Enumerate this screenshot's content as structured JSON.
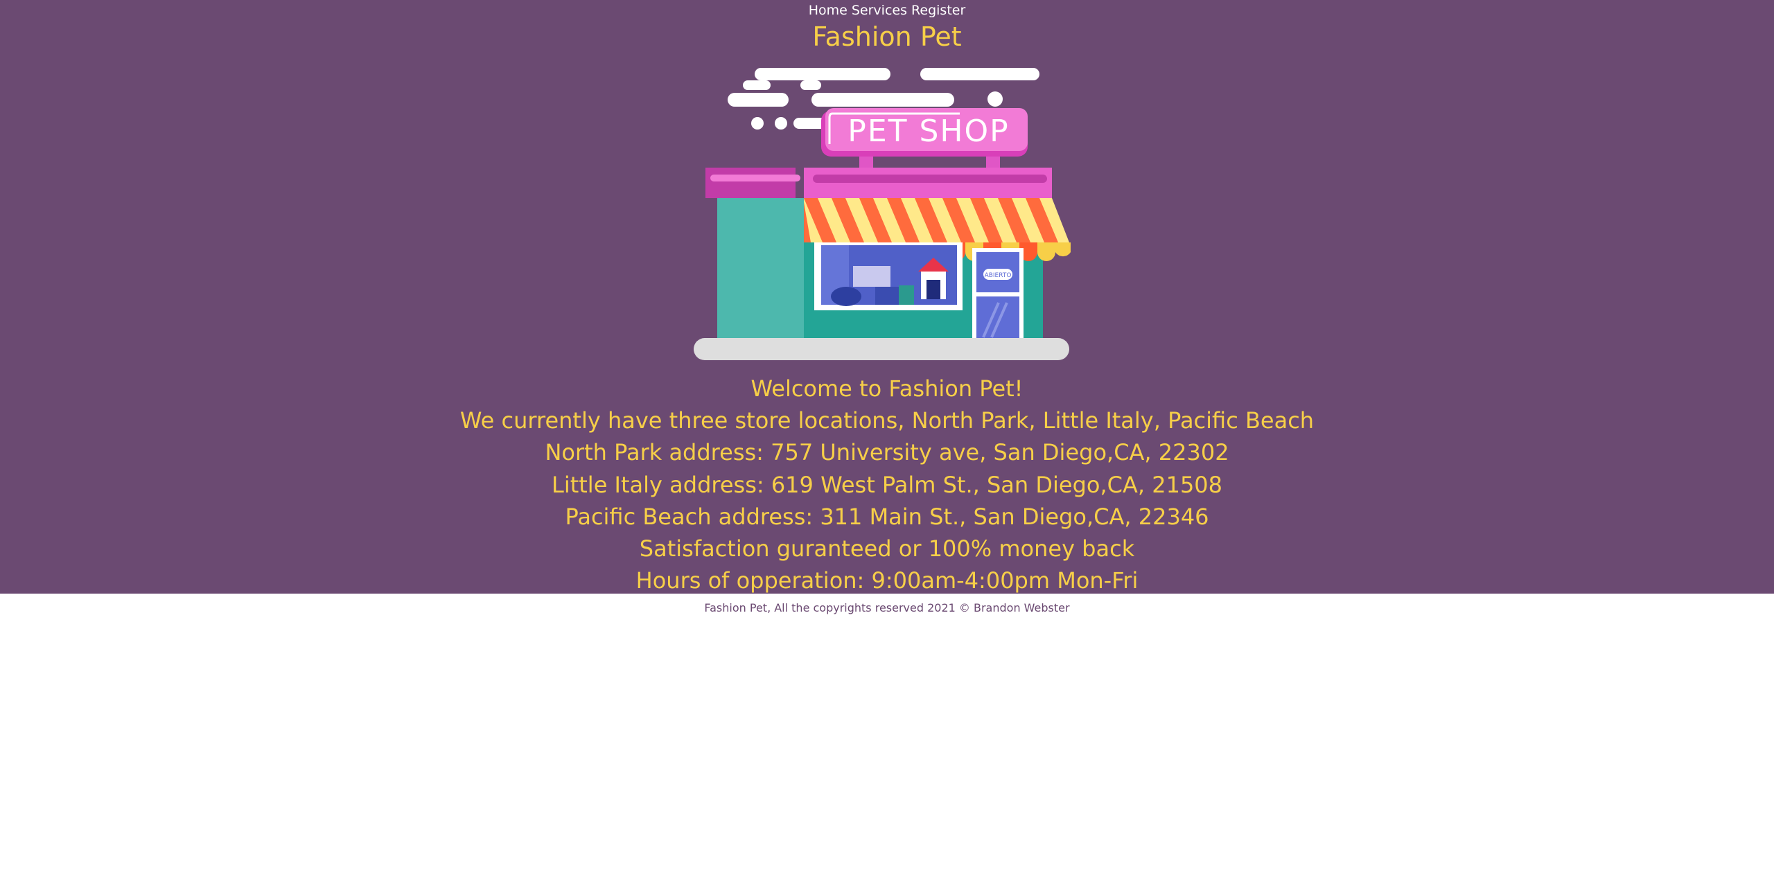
{
  "nav": {
    "home": "Home",
    "services": "Services",
    "register": "Register"
  },
  "header": {
    "title": "Fashion Pet"
  },
  "illustration": {
    "sign_text": "PET SHOP",
    "door_sign_text": "ABIERTO"
  },
  "main": {
    "welcome": "Welcome to Fashion Pet!",
    "locations": "We currently have three store locations, North Park, Little Italy, Pacific Beach",
    "north_park": "North Park address: 757 University ave, San Diego,CA, 22302",
    "little_italy": "Little Italy address: 619 West Palm St., San Diego,CA, 21508",
    "pacific_beach": "Pacific Beach address: 311 Main St., San Diego,CA, 22346",
    "guarantee": "Satisfaction guranteed or 100% money back",
    "hours": "Hours of opperation: 9:00am-4:00pm Mon-Fri"
  },
  "footer": {
    "text": "Fashion Pet, All the copyrights reserved 2021 © Brandon Webster"
  },
  "colors": {
    "background": "#6b4a72",
    "accent": "#f7cf48",
    "footer_text": "#6b4a72"
  }
}
